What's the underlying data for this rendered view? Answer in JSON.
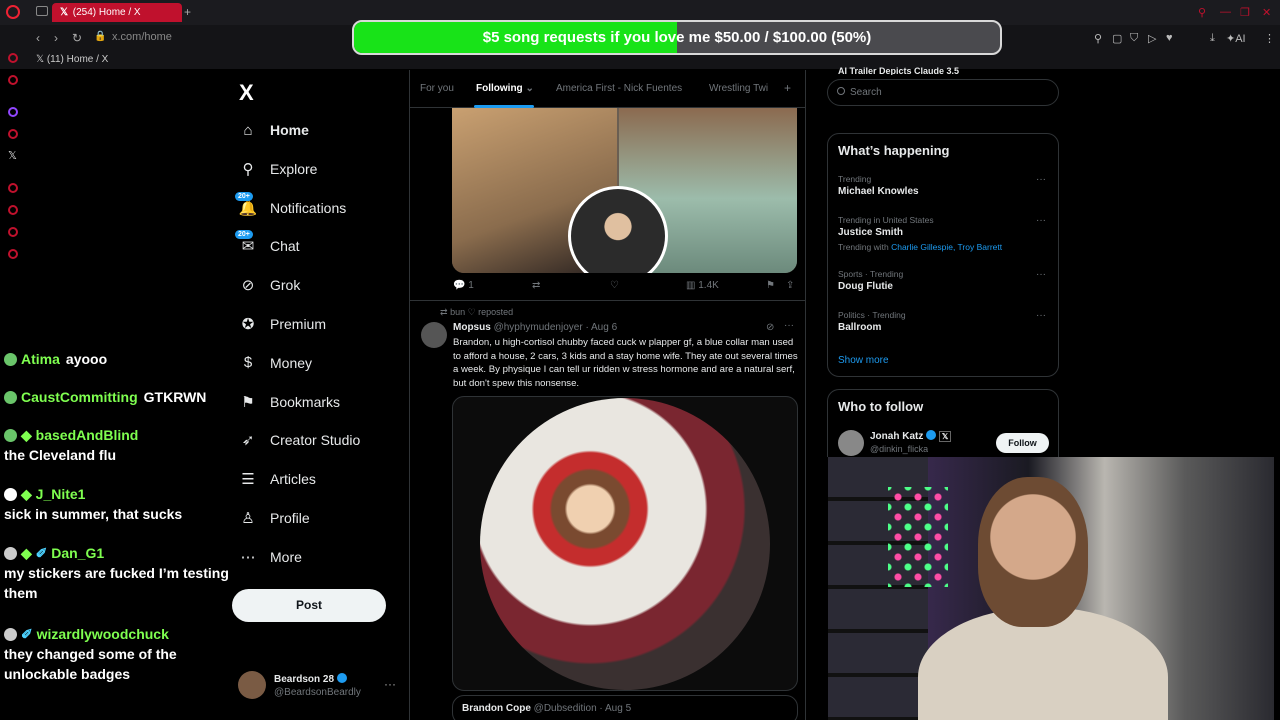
{
  "browser": {
    "tab_title": "(254) Home / X",
    "new_tab": "+",
    "url_host": "x.com/",
    "url_path": "home",
    "bookmark": "(11) Home / X"
  },
  "donation": {
    "text": "$5 song requests if you love me $50.00 / $100.00 (50%)",
    "progress_fraction": 0.5,
    "color": "#18e318"
  },
  "nav": {
    "logo": "X",
    "items": [
      {
        "label": "Home",
        "icon": "home-icon",
        "glyph": "⌂"
      },
      {
        "label": "Explore",
        "icon": "search-icon",
        "glyph": "⚲"
      },
      {
        "label": "Notifications",
        "icon": "bell-icon",
        "glyph": "🔔",
        "badge": "20+"
      },
      {
        "label": "Chat",
        "icon": "chat-icon",
        "glyph": "✉",
        "badge": "20+"
      },
      {
        "label": "Grok",
        "icon": "grok-icon",
        "glyph": "⊘"
      },
      {
        "label": "Premium",
        "icon": "premium-icon",
        "glyph": "✪"
      },
      {
        "label": "Money",
        "icon": "money-icon",
        "glyph": "$"
      },
      {
        "label": "Bookmarks",
        "icon": "bookmark-icon",
        "glyph": "⚑"
      },
      {
        "label": "Creator Studio",
        "icon": "rocket-icon",
        "glyph": "➶"
      },
      {
        "label": "Articles",
        "icon": "articles-icon",
        "glyph": "☰"
      },
      {
        "label": "Profile",
        "icon": "profile-icon",
        "glyph": "♙"
      },
      {
        "label": "More",
        "icon": "more-icon",
        "glyph": "⋯"
      }
    ],
    "post_label": "Post",
    "account": {
      "name": "Beardson 28",
      "handle": "@BeardsonBeardly",
      "more": "···"
    }
  },
  "feed": {
    "tabs": [
      "For you",
      "Following",
      "America First - Nick Fuentes",
      "Wrestling Twi"
    ],
    "tab_add": "+",
    "tweet1_actions": {
      "reply": "1",
      "views": "1.4K"
    },
    "tweet2": {
      "repost_label": "bun ♡ reposted",
      "name": "Mopsus",
      "handle": "@hyphymudenjoyer",
      "date": "Aug 6",
      "text": "Brandon, u high-cortisol chubby faced cuck w plapper gf, a blue collar man used to afford a house, 2 cars, 3 kids and a stay home wife. They ate out several times a week. By physique I can tell ur ridden w stress hormone and are a natural serf, but don't spew this nonsense."
    },
    "quote2": {
      "name": "Brandon Cope",
      "handle": "@Dubsedition",
      "date": "Aug 5"
    }
  },
  "sidebar": {
    "cut_text": "AI Trailer Depicts Claude 3.5",
    "search_placeholder": "Search",
    "happening_title": "What’s happening",
    "trends": [
      {
        "meta": "Trending",
        "name": "Michael Knowles"
      },
      {
        "meta": "Trending in United States",
        "name": "Justice Smith",
        "with_label": "Trending with",
        "with_names": "Charlie Gillespie, Troy Barrett"
      },
      {
        "meta": "Sports · Trending",
        "name": "Doug Flutie"
      },
      {
        "meta": "Politics · Trending",
        "name": "Ballroom"
      }
    ],
    "trend_more": "···",
    "show_more": "Show more",
    "who_title": "Who to follow",
    "follow": {
      "name": "Jonah Katz",
      "handle": "@dinkin_flicka",
      "button": "Follow"
    }
  },
  "chat": {
    "messages": [
      {
        "user": "Atima",
        "text": "ayooo",
        "badge_color": "#6ac56a"
      },
      {
        "user": "CaustCommitting",
        "text": "GTKRWN",
        "badge_color": "#6ac56a"
      },
      {
        "user": "basedAndBlind",
        "text": "the Cleveland flu",
        "badge_color": "#6ac56a"
      },
      {
        "user": "J_Nite1",
        "text": "sick in summer, that sucks",
        "badge_color": "#ffffff"
      },
      {
        "user": "Dan_G1",
        "text": "my stickers are fucked I’m testing them",
        "badge_color": "#cccccc"
      },
      {
        "user": "wizardlywoodchuck",
        "text": "they changed some of the unlockable badges",
        "badge_color": "#cccccc"
      }
    ]
  }
}
